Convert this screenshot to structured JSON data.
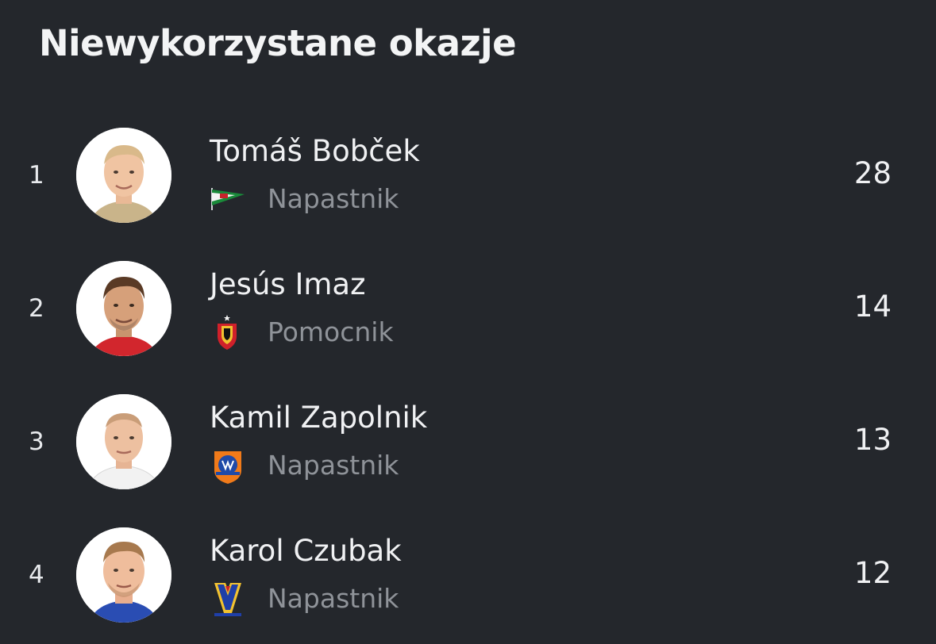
{
  "header": {
    "title": "Niewykorzystane okazje"
  },
  "players": [
    {
      "rank": "1",
      "name": "Tomáš Bobček",
      "position": "Napastnik",
      "value": "28",
      "club_crest": "lechia-flag-crest-icon",
      "shirt_color": "#c9b48a",
      "hair_color": "#d9b98a"
    },
    {
      "rank": "2",
      "name": "Jesús Imaz",
      "position": "Pomocnik",
      "value": "14",
      "club_crest": "jagiellonia-crest-icon",
      "shirt_color": "#d2262d",
      "hair_color": "#5a3a25"
    },
    {
      "rank": "3",
      "name": "Kamil Zapolnik",
      "position": "Napastnik",
      "value": "13",
      "club_crest": "bruk-bet-crest-icon",
      "shirt_color": "#f2f2f2",
      "hair_color": "#c99d78"
    },
    {
      "rank": "4",
      "name": "Karol Czubak",
      "position": "Napastnik",
      "value": "12",
      "club_crest": "motor-crest-icon",
      "shirt_color": "#2a4db3",
      "hair_color": "#a7794e"
    }
  ],
  "colors": {
    "background": "#24272c",
    "primary_text": "#f0f1f3",
    "secondary_text": "#8f9399"
  }
}
